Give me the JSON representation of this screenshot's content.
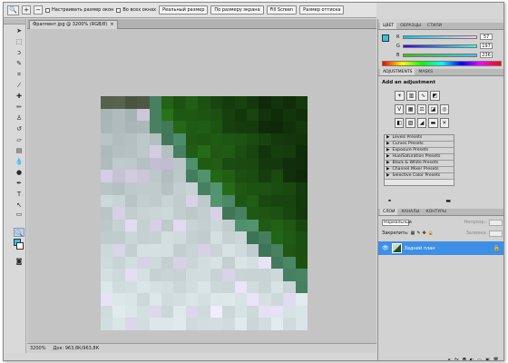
{
  "options_bar": {
    "tool_icon": "zoom-icon",
    "zoom_in": "+",
    "zoom_out": "−",
    "resize_windows_label": "Настраивать размер окон",
    "all_windows_label": "Во всех окнах",
    "actual_pixels": "Реальный размер",
    "fit_screen": "По размеру экрана",
    "fill_screen": "Fill Screen",
    "print_size": "Размер оттиска"
  },
  "document": {
    "tab_title": "Фрагмент.jpg @ 3200% (RGB/8)",
    "close": "×",
    "status_zoom": "3200%",
    "status_doc": "Док: 963,8К/963,8К"
  },
  "colors": {
    "foreground": "#35c2e0",
    "background": "#ffffff",
    "selected_layer": "#3d8fe6"
  },
  "color_panel": {
    "tabs": [
      "ЦВЕТ",
      "ОБРАЗЦЫ",
      "СТИЛИ"
    ],
    "sliders": [
      {
        "label": "R",
        "value": "57"
      },
      {
        "label": "G",
        "value": "197"
      },
      {
        "label": "B",
        "value": "236"
      }
    ]
  },
  "adjustments": {
    "tabs": [
      "ADJUSTMENTS",
      "MASKS"
    ],
    "title": "Add an adjustment",
    "presets": [
      "Levels Presets",
      "Curves Presets",
      "Exposure Presets",
      "Hue/Saturation Presets",
      "Black & White Presets",
      "Channel Mixer Presets",
      "Selective Color Presets"
    ]
  },
  "layers": {
    "tabs": [
      "СЛОИ",
      "КАНАЛЫ",
      "КОНТУРЫ"
    ],
    "blend_mode": "Нормальный",
    "opacity_label": "Непрозр.:",
    "fill_label": "Заливка:",
    "lock_label": "Закрепить:",
    "layer_name": "Задний план"
  }
}
